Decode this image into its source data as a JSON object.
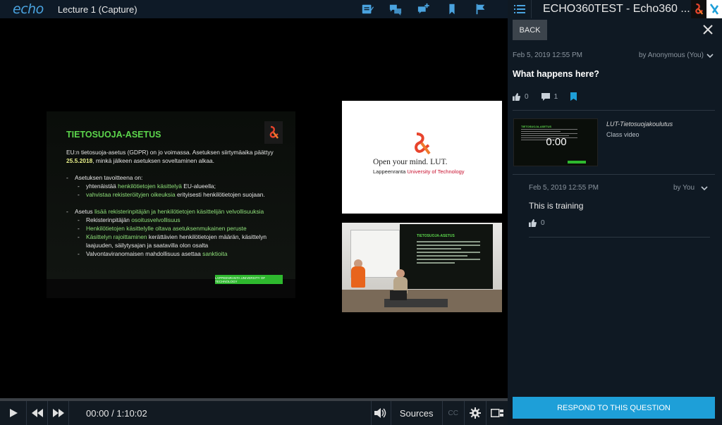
{
  "app": {
    "logo": "echo",
    "lecture_title": "Lecture 1 (Capture)"
  },
  "top_icons": [
    "notes-icon",
    "discussion-icon",
    "add-question-icon",
    "bookmark-icon",
    "flag-icon"
  ],
  "slide": {
    "title": "TIETOSUOJA-ASETUS",
    "intro_a": "EU:n tietosuoja-asetus (GDPR) on jo voimassa. Asetuksen siirtymäaika päättyy ",
    "intro_date": "25.5.2018",
    "intro_b": ", minkä jälkeen asetuksen soveltaminen alkaa.",
    "goal_heading": "Asetuksen tavoitteena on:",
    "goal1_a": "yhtenäistää ",
    "goal1_g": "henkilötietojen käsittelyä",
    "goal1_b": " EU-alueella;",
    "goal2_g": "vahvistaa rekisteröityjen oikeuksia",
    "goal2_b": " erityisesti henkilötietojen suojaan.",
    "asetus_a": "Asetus ",
    "asetus_g": "lisää rekisterinpitäjän ja henkilötietojen käsittelijän velvollisuuksia",
    "item1_a": "Rekisterinpitäjän ",
    "item1_g": "osoitusvelvollisuus",
    "item2_g": "Henkilötietojen käsittelylle oltava asetuksenmukainen peruste",
    "item3_g": "Käsittelyn rajoittaminen",
    "item3_b": " kerättävien henkilötietojen määrän, käsittelyn laajuuden, säilytysajan ja saatavilla olon osalta",
    "item4_a": "Valvontaviranomaisen mahdollisuus asettaa ",
    "item4_g": "sanktioita",
    "footer": "LAPPEENRANTA UNIVERSITY OF TECHNOLOGY"
  },
  "camera_top": {
    "slogan": "Open your mind. LUT.",
    "sub_a": "Lappeenranta ",
    "sub_red": "University of Technology"
  },
  "camera_bottom": {
    "proj_title": "TIETOSUOJA-ASETUS"
  },
  "controls": {
    "time": "00:00 / 1:10:02",
    "sources": "Sources",
    "cc": "CC",
    "progress": 0
  },
  "panel": {
    "title": "ECHO360TEST - Echo360 ...",
    "back": "BACK",
    "question": {
      "date": "Feb 5, 2019 12:55 PM",
      "author": "by Anonymous (You)",
      "text": "What happens here?",
      "likes": "0",
      "replies": "1"
    },
    "video": {
      "thumb_time": "0:00",
      "thumb_title": "TIETOSUOJA-ASETUS",
      "title": "LUT-Tietosuojakoulutus",
      "type": "Class video"
    },
    "reply": {
      "date": "Feb 5, 2019 12:55 PM",
      "author": "by You",
      "text": "This is training",
      "likes": "0"
    },
    "respond": "RESPOND TO THIS QUESTION"
  }
}
